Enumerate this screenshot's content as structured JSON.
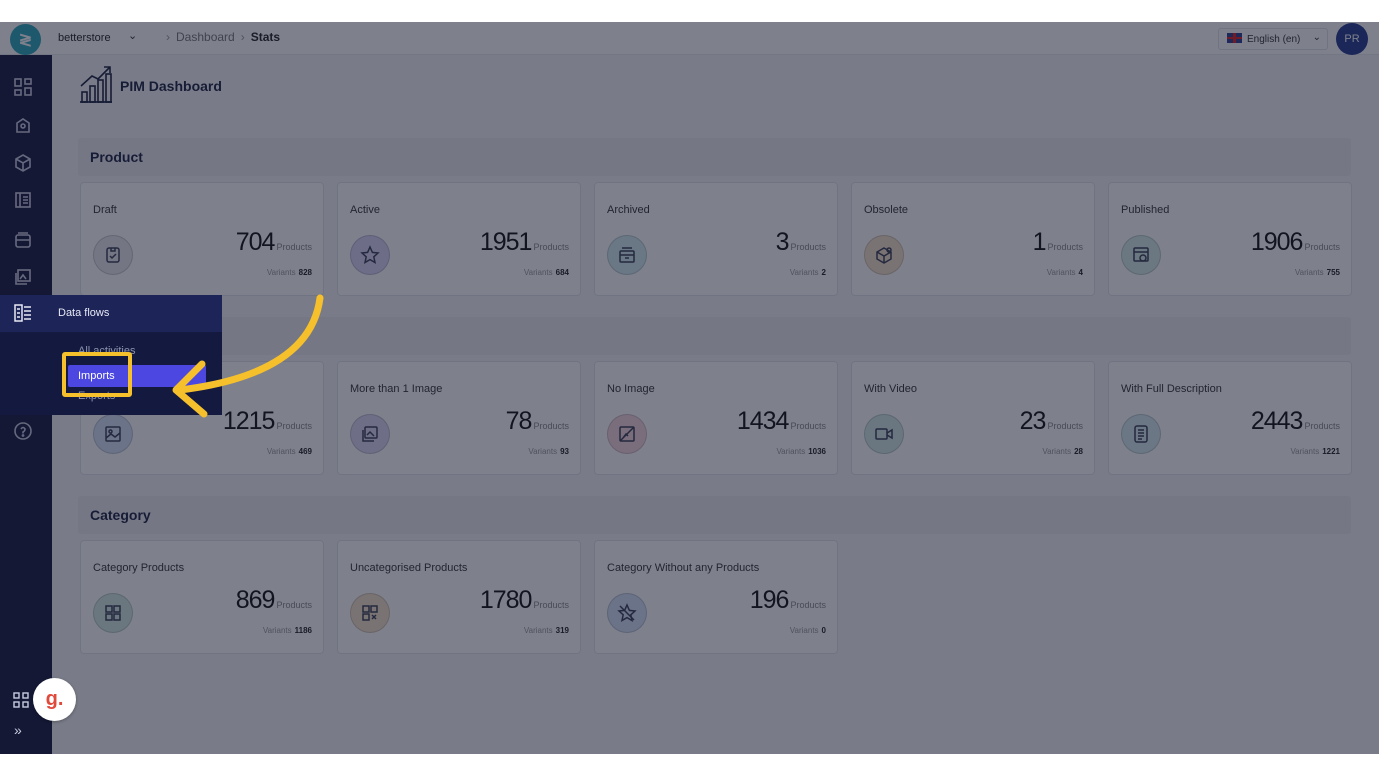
{
  "topbar": {
    "store": "betterstore",
    "breadcrumb": [
      "Dashboard",
      "Stats"
    ],
    "language": "English (en)",
    "avatar_initials": "PR"
  },
  "page": {
    "title": "PIM Dashboard"
  },
  "sections": [
    {
      "title": "Product"
    },
    {
      "title": ""
    },
    {
      "title": "Category"
    }
  ],
  "cards": [
    {
      "label": "Draft",
      "value": "704",
      "unit": "Products",
      "variants_label": "Variants",
      "variants": "828",
      "icon": "draft-icon",
      "color": "#e8e8ec"
    },
    {
      "label": "Active",
      "value": "1951",
      "unit": "Products",
      "variants_label": "Variants",
      "variants": "684",
      "icon": "star-icon",
      "color": "#d9d6f5"
    },
    {
      "label": "Archived",
      "value": "3",
      "unit": "Products",
      "variants_label": "Variants",
      "variants": "2",
      "icon": "archive-icon",
      "color": "#d3ecef"
    },
    {
      "label": "Obsolete",
      "value": "1",
      "unit": "Products",
      "variants_label": "Variants",
      "variants": "4",
      "icon": "box-icon",
      "color": "#f6e3c9"
    },
    {
      "label": "Published",
      "value": "1906",
      "unit": "Products",
      "variants_label": "Variants",
      "variants": "755",
      "icon": "publish-icon",
      "color": "#d4ede7"
    },
    {
      "label": "",
      "value": "1215",
      "unit": "Products",
      "variants_label": "Variants",
      "variants": "469",
      "icon": "image-icon",
      "color": "#d6e3f5"
    },
    {
      "label": "More than 1 Image",
      "value": "78",
      "unit": "Products",
      "variants_label": "Variants",
      "variants": "93",
      "icon": "images-icon",
      "color": "#dcdaf1"
    },
    {
      "label": "No Image",
      "value": "1434",
      "unit": "Products",
      "variants_label": "Variants",
      "variants": "1036",
      "icon": "no-image-icon",
      "color": "#f6d8dd"
    },
    {
      "label": "With Video",
      "value": "23",
      "unit": "Products",
      "variants_label": "Variants",
      "variants": "28",
      "icon": "video-icon",
      "color": "#d2ece6"
    },
    {
      "label": "With Full Description",
      "value": "2443",
      "unit": "Products",
      "variants_label": "Variants",
      "variants": "1221",
      "icon": "document-icon",
      "color": "#d6ebef"
    },
    {
      "label": "Category Products",
      "value": "869",
      "unit": "Products",
      "variants_label": "Variants",
      "variants": "1186",
      "icon": "grid-icon",
      "color": "#d3ece3"
    },
    {
      "label": "Uncategorised Products",
      "value": "1780",
      "unit": "Products",
      "variants_label": "Variants",
      "variants": "319",
      "icon": "grid-x-icon",
      "color": "#f5e3c8"
    },
    {
      "label": "Category Without any Products",
      "value": "196",
      "unit": "Products",
      "variants_label": "Variants",
      "variants": "0",
      "icon": "star-off-icon",
      "color": "#d6e2f5"
    }
  ],
  "flyout": {
    "title": "Data flows",
    "items": [
      "All activities",
      "Imports",
      "Exports"
    ],
    "selected": "Imports"
  },
  "colors": {
    "sidebar": "#141a3f",
    "highlight": "#f5c02b",
    "selected_item": "#4b47e0"
  }
}
